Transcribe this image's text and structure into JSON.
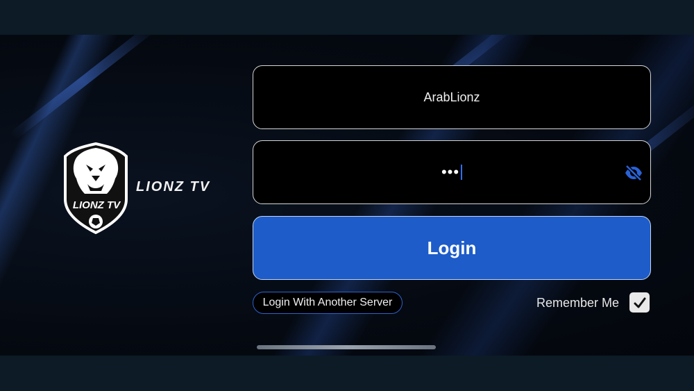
{
  "brand": {
    "name": "LIONZ TV",
    "badge_text": "LIONZ TV"
  },
  "username": {
    "value": "ArabLionz"
  },
  "password": {
    "masked": "•••",
    "toggle_icon": "eye-slash-icon"
  },
  "login_button": {
    "label": "Login"
  },
  "server_button": {
    "label": "Login With Another Server"
  },
  "remember": {
    "label": "Remember Me",
    "checked": true
  },
  "colors": {
    "accent": "#1d5cc9",
    "eye_icon": "#2a62d6",
    "background": "#050a12"
  }
}
